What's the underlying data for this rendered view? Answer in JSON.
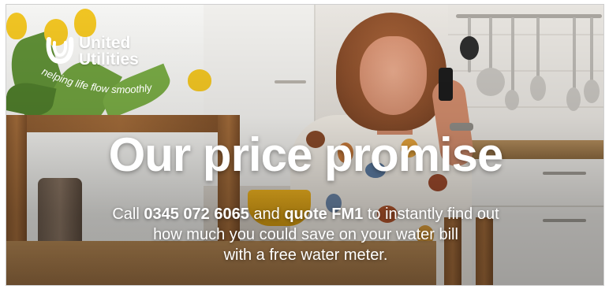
{
  "brand": {
    "name_line1": "United",
    "name_line2": "Utilities",
    "tagline": "helping life flow smoothly",
    "logo_icon": "united-utilities-logo-icon"
  },
  "headline": "Our price promise",
  "body": {
    "intro": "Call ",
    "phone": "0345 072 6065",
    "and": " and ",
    "quote": "quote FM1",
    "rest_line1": " to instantly find out",
    "line2": "how much you could save on your water bill",
    "line3": "with a free water meter."
  },
  "colors": {
    "text": "#ffffff",
    "accent_yellow": "#f2b520"
  }
}
